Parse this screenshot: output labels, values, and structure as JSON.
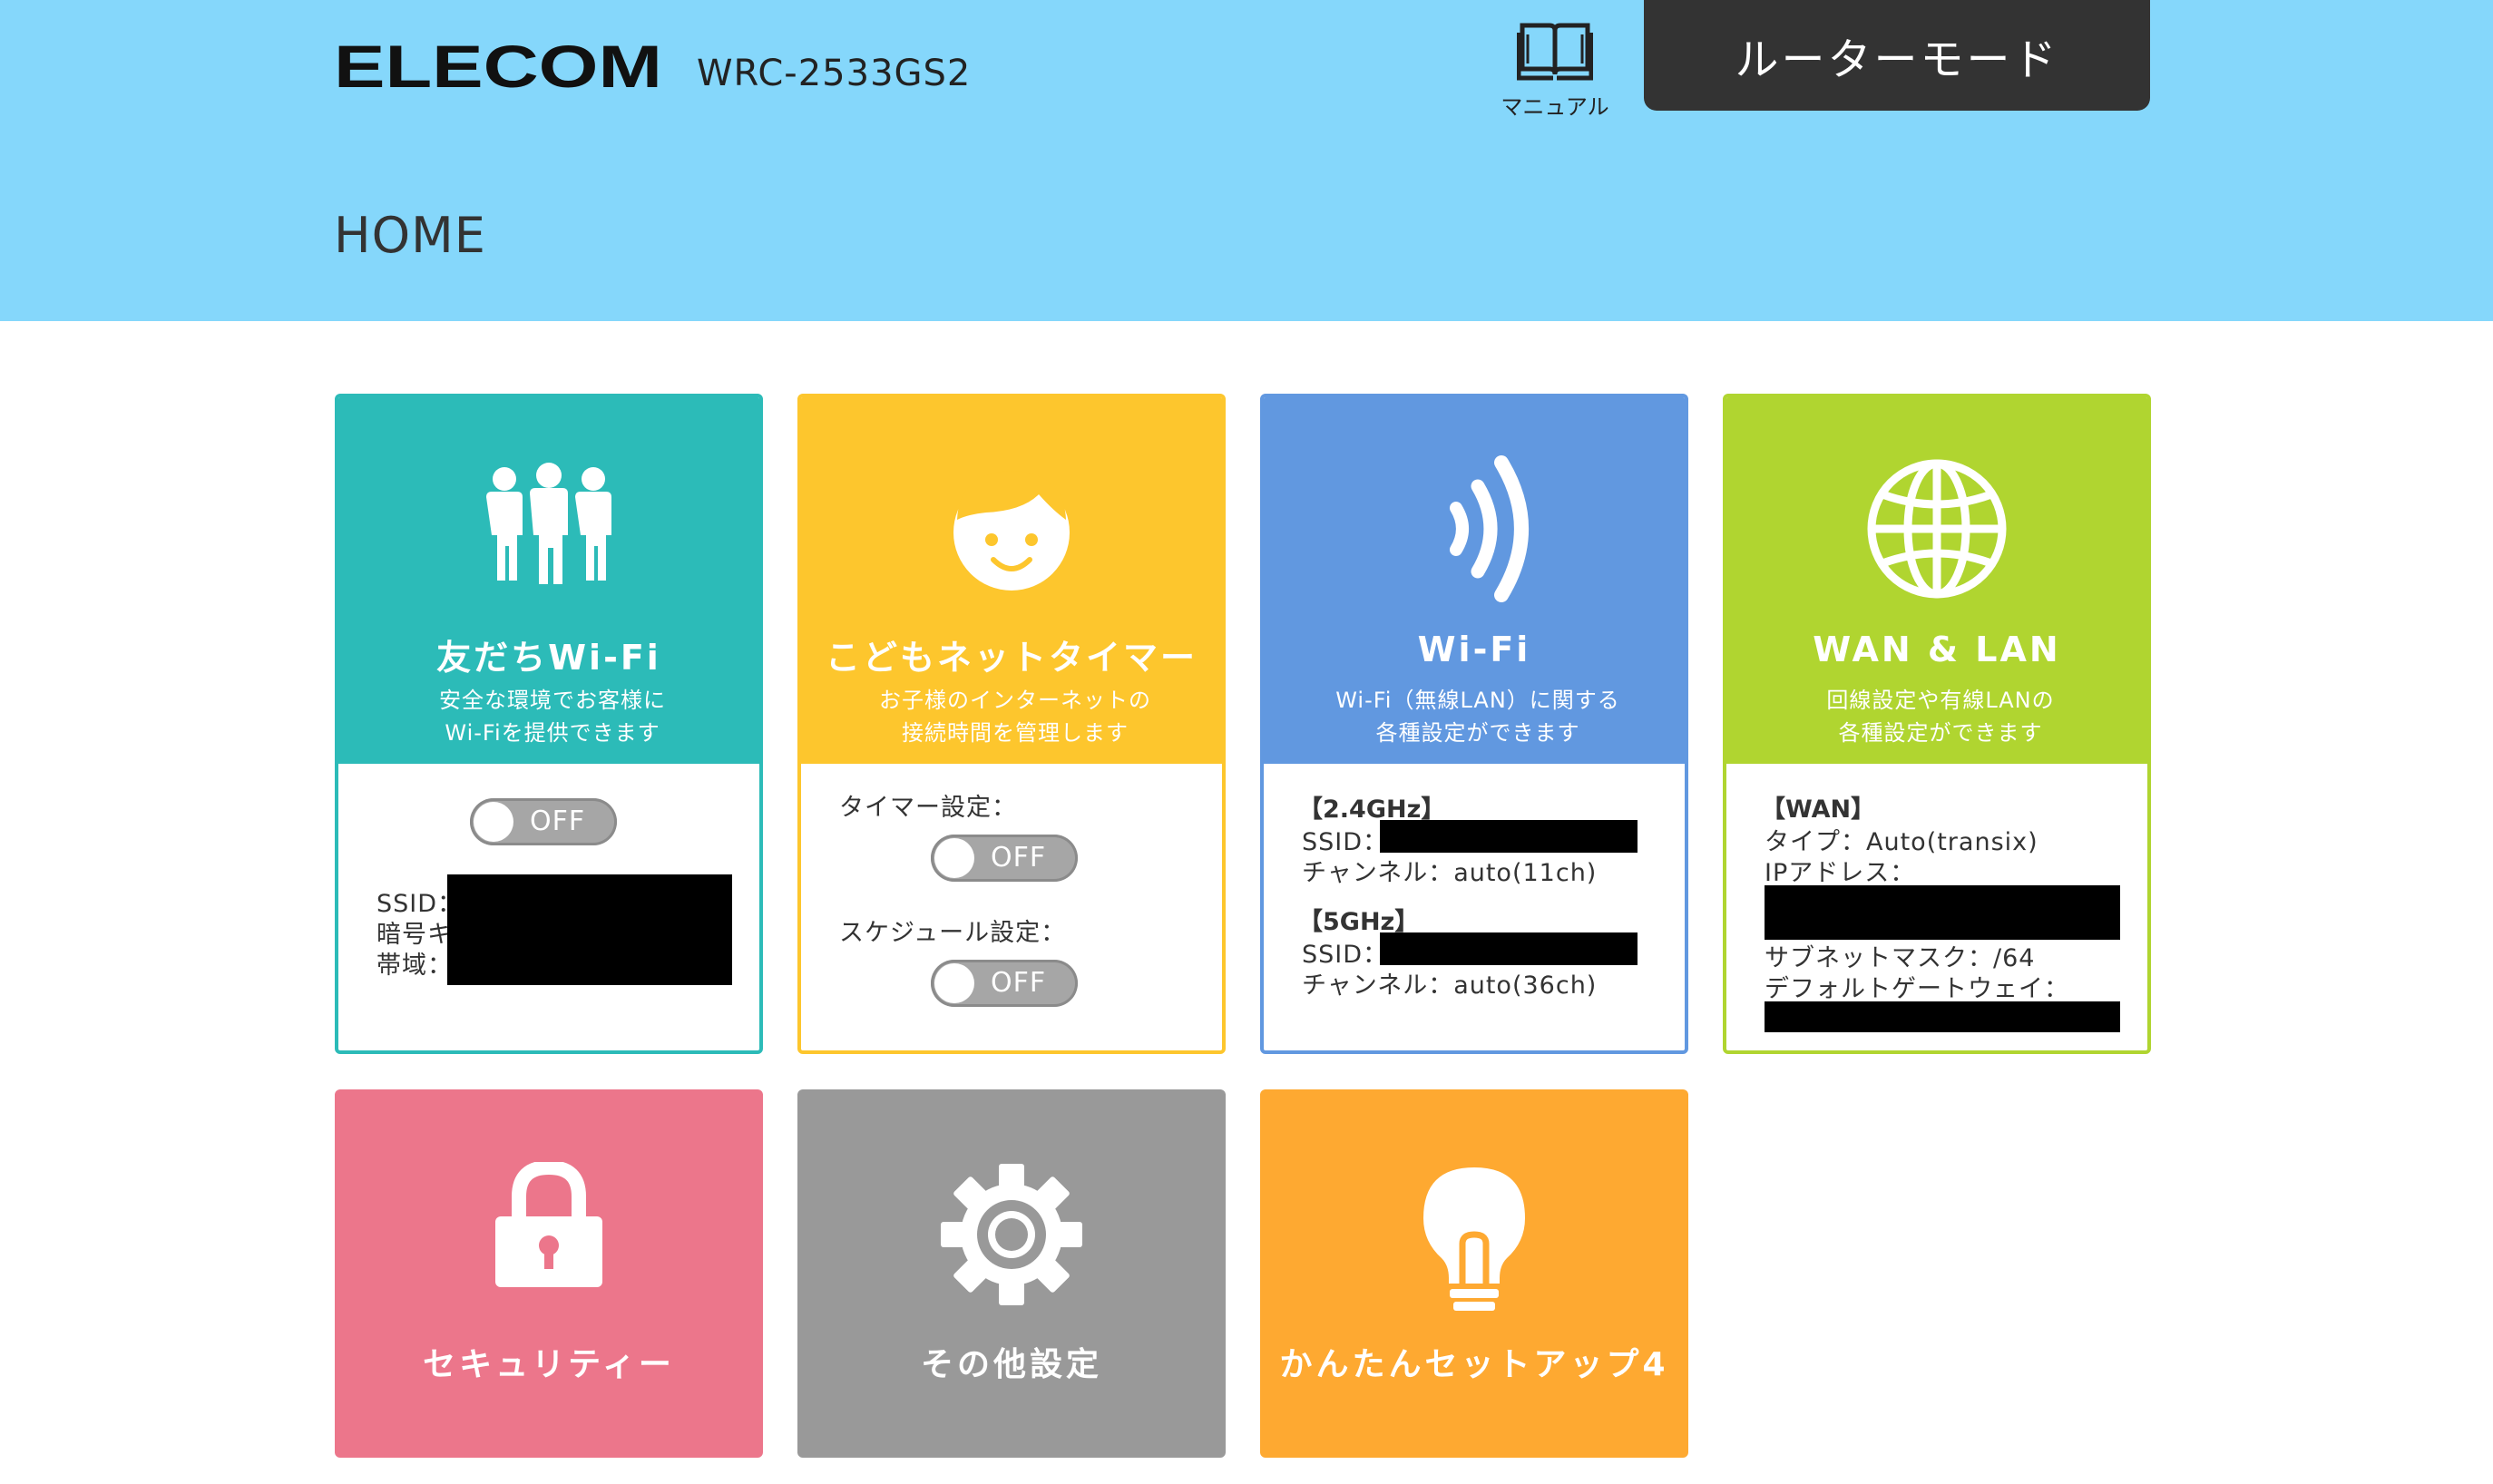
{
  "header": {
    "brand": "ELECOM",
    "model": "WRC-2533GS2",
    "manual_label": "マニュアル",
    "mode_label": "ルーターモード",
    "page_title": "HOME",
    "bg_color": "#85d7fb"
  },
  "tiles": {
    "friend_wifi": {
      "title": "友だちWi-Fi",
      "desc_line1": "安全な環境でお客様に",
      "desc_line2": "Wi-Fiを提供できます",
      "color": "#2cbbb8",
      "icon": "people-icon",
      "toggle": "OFF",
      "ssid_label": "SSID：",
      "key_label": "暗号キ",
      "band_label": "帯域："
    },
    "kids_timer": {
      "title": "こどもネットタイマー",
      "desc_line1": "お子様のインターネットの",
      "desc_line2": "接続時間を管理します",
      "color": "#fdc62d",
      "icon": "child-face-icon",
      "timer_label": "タイマー設定：",
      "timer_toggle": "OFF",
      "schedule_label": "スケジュール設定：",
      "schedule_toggle": "OFF"
    },
    "wifi": {
      "title": "Wi-Fi",
      "desc_line1": "Wi-Fi（無線LAN）に関する",
      "desc_line2": "各種設定ができます",
      "color": "#6198e0",
      "icon": "wifi-signal-icon",
      "band24_title": "【2.4GHz】",
      "band24_ssid_label": "SSID：",
      "band24_channel": "チャンネル：auto(11ch)",
      "band5_title": "【5GHz】",
      "band5_ssid_label": "SSID：",
      "band5_channel": "チャンネル：auto(36ch)"
    },
    "wan_lan": {
      "title": "WAN & LAN",
      "desc_line1": "回線設定や有線LANの",
      "desc_line2": "各種設定ができます",
      "color": "#b0d530",
      "icon": "globe-icon",
      "wan_title": "【WAN】",
      "type": "タイプ：Auto(transix)",
      "ip_label": "IPアドレス：",
      "subnet": "サブネットマスク：/64",
      "gateway_label": "デフォルトゲートウェイ："
    },
    "security": {
      "title": "セキュリティー",
      "color": "#ec768b",
      "icon": "lock-icon"
    },
    "other": {
      "title": "その他設定",
      "color": "#999999",
      "icon": "gear-icon"
    },
    "setup": {
      "title": "かんたんセットアップ4",
      "color": "#fea931",
      "icon": "lightbulb-icon"
    }
  }
}
